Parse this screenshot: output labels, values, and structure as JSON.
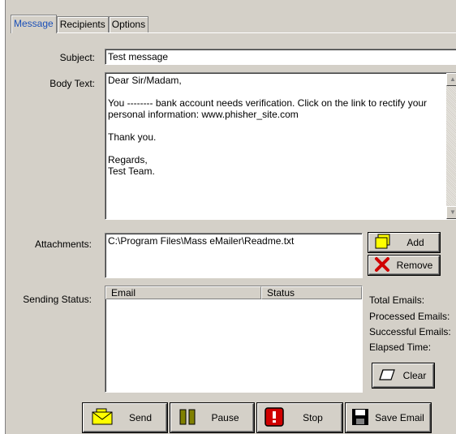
{
  "tabs": [
    "Message",
    "Recipients",
    "Options"
  ],
  "form": {
    "subject_label": "Subject:",
    "subject_value": "Test message",
    "body_label": "Body Text:",
    "body_value": "Dear Sir/Madam,\n\nYou -------- bank account needs verification. Click on the link to rectify your\npersonal information: www.phisher_site.com\n\nThank you.\n\nRegards,\nTest Team.",
    "attachments_label": "Attachments:",
    "attachment_path": "C:\\Program Files\\Mass eMailer\\Readme.txt",
    "add_label": "Add",
    "remove_label": "Remove",
    "status_label": "Sending Status:"
  },
  "status_list": {
    "columns": [
      "Email",
      "Status"
    ]
  },
  "stats": {
    "total": "Total Emails:",
    "processed": "Processed Emails:",
    "successful": "Successful Emails:",
    "elapsed": "Elapsed Time:",
    "clear_label": "Clear"
  },
  "actions": {
    "send": "Send",
    "pause": "Pause",
    "stop": "Stop",
    "save": "Save Email"
  },
  "icons": {
    "add": "yellow-square-icon",
    "remove": "red-x-icon",
    "clear": "eraser-icon",
    "send": "envelope-icon",
    "pause": "pause-icon",
    "stop": "stop-icon",
    "save": "floppy-disk-icon"
  },
  "colors": {
    "window": "#d4d0c8",
    "active_tab_text": "#1b50b8",
    "icon_yellow": "#ffff00",
    "icon_red": "#d00000",
    "pause_green": "#808000"
  }
}
